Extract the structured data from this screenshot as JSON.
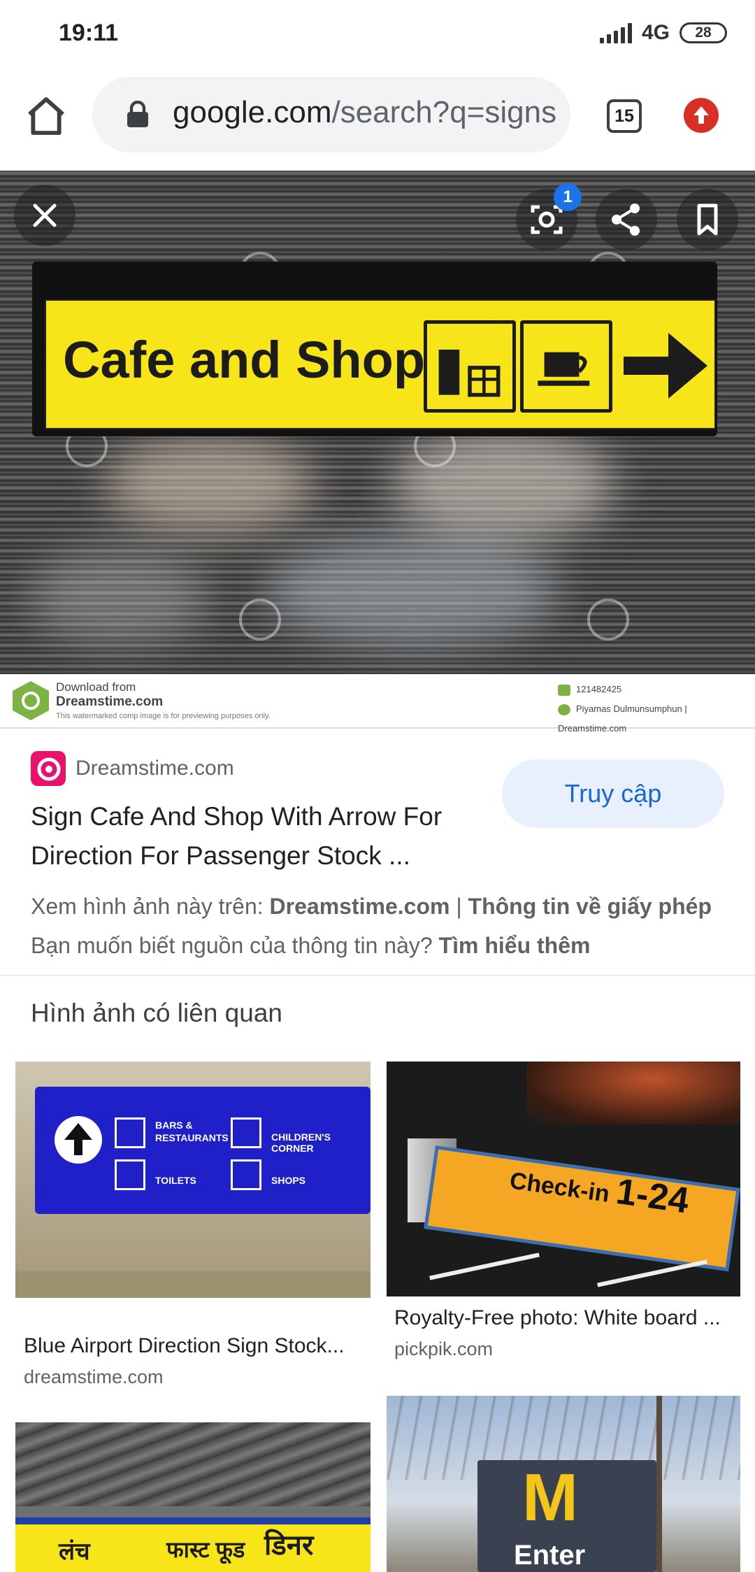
{
  "status_bar": {
    "time": "19:11",
    "network": "4G",
    "battery": "28"
  },
  "toolbar": {
    "url_host": "google.com",
    "url_path": "/search?q=signs",
    "tab_count": "15",
    "icons": [
      "home-icon",
      "lock-icon",
      "tabs-icon",
      "update-icon"
    ]
  },
  "viewer": {
    "sign_text": "Cafe and Shop",
    "badge_count": "1",
    "icons": [
      "close-icon",
      "lens-icon",
      "share-icon",
      "bookmark-icon"
    ]
  },
  "watermark": {
    "line1": "Download from",
    "line2": "Dreamstime.com",
    "line3": "This watermarked comp image is for previewing purposes only.",
    "id": "121482425",
    "credit": "Piyamas Dulmunsumphun | Dreamstime.com"
  },
  "result": {
    "source": "Dreamstime.com",
    "visit_label": "Truy cập",
    "title": "Sign Cafe And Shop With Arrow For Direction For Passenger Stock ...",
    "view_prefix": "Xem hình ảnh này trên: ",
    "view_site": "Dreamstime.com",
    "view_sep": " | ",
    "license": "Thông tin về giấy phép",
    "learn_prefix": "Bạn muốn biết nguồn của thông tin này? ",
    "learn_link": "Tìm hiểu thêm"
  },
  "related": {
    "heading": "Hình ảnh có liên quan",
    "items": [
      {
        "caption": "Blue Airport Direction Sign Stock...",
        "source": "dreamstime.com",
        "labels": [
          "BARS &",
          "RESTAURANTS",
          "CHILDREN'S CORNER",
          "TOILETS",
          "SHOPS"
        ]
      },
      {
        "caption": "Royalty-Free photo: White board ...",
        "source": "pickpik.com",
        "labels": [
          "Check-in",
          "1-24"
        ]
      },
      {
        "caption": "",
        "source": "",
        "labels": [
          "लंच",
          "फास्ट फूड",
          "डिनर"
        ]
      },
      {
        "caption": "",
        "source": "",
        "labels": [
          "M",
          "Enter"
        ]
      }
    ]
  },
  "colors": {
    "accent": "#1967d2",
    "visit_bg": "#e8f0fe",
    "sign_yellow": "#f7e51a",
    "airport_blue": "#1f20c8",
    "dreamstime_pink": "#e8116b",
    "update_red": "#d93025"
  }
}
